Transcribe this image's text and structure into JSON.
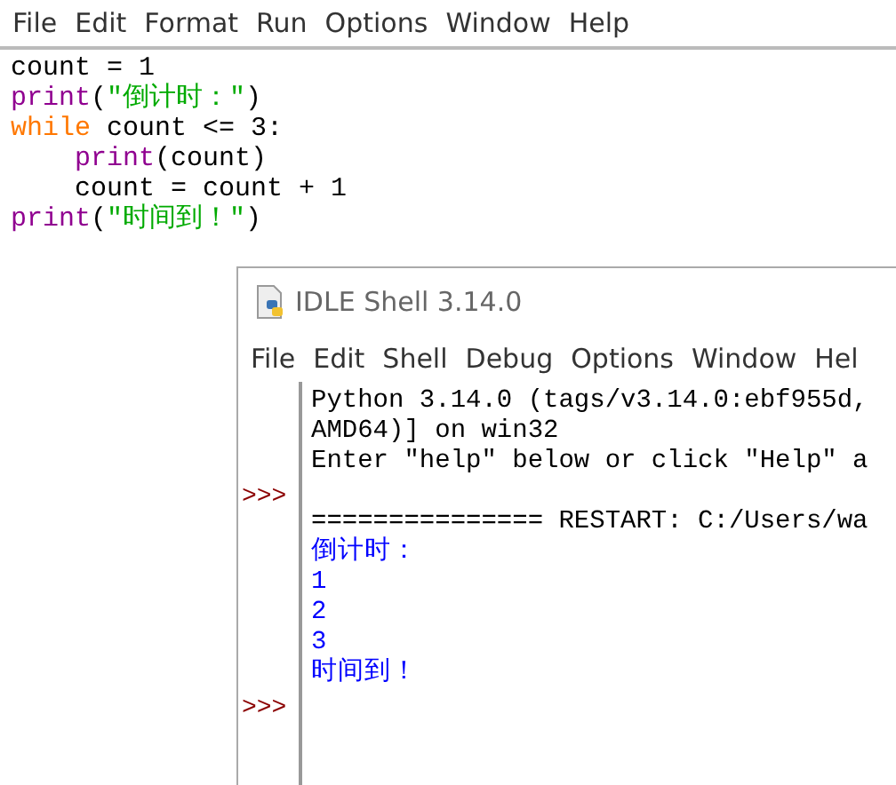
{
  "editor": {
    "menu": [
      "File",
      "Edit",
      "Format",
      "Run",
      "Options",
      "Window",
      "Help"
    ],
    "lines": [
      {
        "indented": false,
        "tokens": [
          {
            "text": "count = 1",
            "kind": "plain"
          }
        ]
      },
      {
        "indented": false,
        "tokens": [
          {
            "text": "print",
            "kind": "builtin"
          },
          {
            "text": "(",
            "kind": "plain"
          },
          {
            "text": "\"倒计时：\"",
            "kind": "string"
          },
          {
            "text": ")",
            "kind": "plain"
          }
        ]
      },
      {
        "indented": false,
        "tokens": [
          {
            "text": "while",
            "kind": "keyword"
          },
          {
            "text": " count <= 3:",
            "kind": "plain"
          }
        ]
      },
      {
        "indented": true,
        "tokens": [
          {
            "text": "print",
            "kind": "builtin"
          },
          {
            "text": "(count)",
            "kind": "plain"
          }
        ]
      },
      {
        "indented": true,
        "tokens": [
          {
            "text": "count = count + 1",
            "kind": "plain"
          }
        ]
      },
      {
        "indented": false,
        "tokens": [
          {
            "text": "print",
            "kind": "builtin"
          },
          {
            "text": "(",
            "kind": "plain"
          },
          {
            "text": "\"时间到！\"",
            "kind": "string"
          },
          {
            "text": ")",
            "kind": "plain"
          }
        ]
      }
    ]
  },
  "shell": {
    "title": "IDLE Shell 3.14.0",
    "menu": [
      "File",
      "Edit",
      "Shell",
      "Debug",
      "Options",
      "Window",
      "Hel"
    ],
    "lines": [
      {
        "text": "Python 3.14.0 (tags/v3.14.0:ebf955d,",
        "kind": "info"
      },
      {
        "text": "AMD64)] on win32",
        "kind": "info"
      },
      {
        "text": "Enter \"help\" below or click \"Help\" a",
        "kind": "info"
      },
      {
        "kind": "prompt",
        "prompt": ">>>"
      },
      {
        "text": "=============== RESTART: C:/Users/wa",
        "kind": "info"
      },
      {
        "text": "倒计时：",
        "kind": "stdout"
      },
      {
        "text": "1",
        "kind": "stdout"
      },
      {
        "text": "2",
        "kind": "stdout"
      },
      {
        "text": "3",
        "kind": "stdout"
      },
      {
        "text": "时间到！",
        "kind": "stdout"
      },
      {
        "kind": "prompt",
        "prompt": ">>>"
      }
    ]
  }
}
